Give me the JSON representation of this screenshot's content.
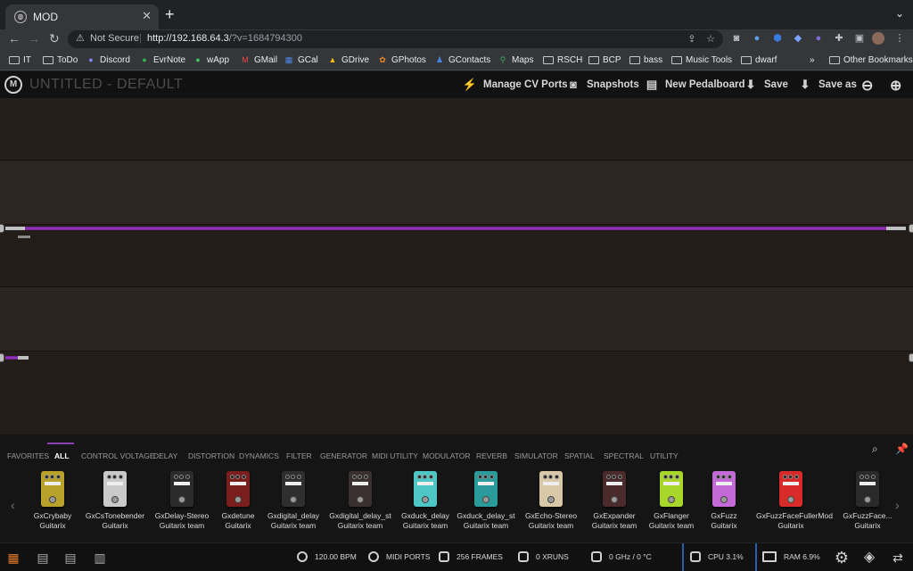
{
  "browser": {
    "tab": {
      "title": "MOD",
      "favicon": "mod-logo-icon"
    },
    "address": {
      "security": "Not Secure",
      "url_host": "http://192.168.64.3",
      "url_rest": "/?v=1684794300"
    },
    "bookmarks": [
      "IT",
      "ToDo",
      "Discord",
      "EvrNote",
      "wApp",
      "GMail",
      "GCal",
      "GDrive",
      "GPhotos",
      "GContacts",
      "Maps",
      "RSCH",
      "BCP",
      "bass",
      "Music Tools",
      "dwarf"
    ],
    "more": "»",
    "other_bookmarks": "Other Bookmarks"
  },
  "app": {
    "title": "UNTITLED - DEFAULT",
    "header_buttons": [
      "Manage CV Ports",
      "Snapshots",
      "New Pedalboard",
      "Save",
      "Save as"
    ]
  },
  "plugin_bar": {
    "categories": [
      "FAVORITES",
      "ALL",
      "CONTROL VOLTAGE",
      "DELAY",
      "DISTORTION",
      "DYNAMICS",
      "FILTER",
      "GENERATOR",
      "MIDI UTILITY",
      "MODULATOR",
      "REVERB",
      "SIMULATOR",
      "SPATIAL",
      "SPECTRAL",
      "UTILITY"
    ],
    "active_category": "ALL",
    "plugins": [
      {
        "name": "GxCrybaby",
        "author": "Guitarix",
        "color": "#b8a22a"
      },
      {
        "name": "GxCsTonebender",
        "author": "Guitarix",
        "color": "#c9c9c9"
      },
      {
        "name": "GxDelay-Stereo",
        "author": "Guitarix team",
        "color": "#2b2b2b"
      },
      {
        "name": "Gxdetune",
        "author": "Guitarix",
        "color": "#7a1d1d"
      },
      {
        "name": "Gxdigital_delay",
        "author": "Guitarix team",
        "color": "#2f2f2f"
      },
      {
        "name": "Gxdigital_delay_st",
        "author": "Guitarix team",
        "color": "#3a3030"
      },
      {
        "name": "Gxduck_delay",
        "author": "Guitarix team",
        "color": "#4fc6c6"
      },
      {
        "name": "Gxduck_delay_st",
        "author": "Guitarix team",
        "color": "#2b9a9a"
      },
      {
        "name": "GxEcho-Stereo",
        "author": "Guitarix team",
        "color": "#d9c8a8"
      },
      {
        "name": "GxExpander",
        "author": "Guitarix team",
        "color": "#4a2a2a"
      },
      {
        "name": "GxFlanger",
        "author": "Guitarix team",
        "color": "#a8d62a"
      },
      {
        "name": "GxFuzz",
        "author": "Guitarix",
        "color": "#c46ad6"
      },
      {
        "name": "GxFuzzFaceFullerMod",
        "author": "Guitarix",
        "color": "#d92a2a"
      },
      {
        "name": "GxFuzzFace...",
        "author": "Guitarix",
        "color": "#2a2a2a"
      }
    ]
  },
  "status": {
    "bpm": "120.00 BPM",
    "midi": "MIDI PORTS",
    "frames": "256 FRAMES",
    "xruns": "0 XRUNS",
    "clock": "0 GHz / 0 °C",
    "cpu": "CPU 3.1%",
    "ram": "RAM 6.9%"
  }
}
